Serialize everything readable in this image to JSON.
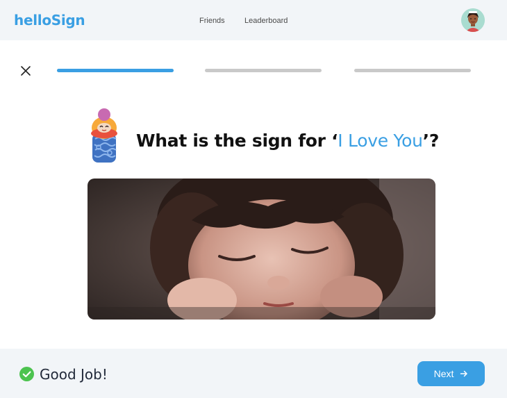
{
  "header": {
    "brand": "helloSign",
    "nav": [
      {
        "label": "Friends"
      },
      {
        "label": "Leaderboard"
      }
    ]
  },
  "progress": {
    "segments": [
      {
        "filled": 1.0
      },
      {
        "filled": 0.0
      },
      {
        "filled": 0.0
      }
    ]
  },
  "question": {
    "prefix": "What is the sign for ‘",
    "highlight": "I Love You",
    "suffix": "’?"
  },
  "footer": {
    "status": "Good Job!",
    "next_label": "Next"
  },
  "colors": {
    "accent": "#3a9fe3",
    "success": "#4cc34f",
    "header_bg": "#f2f5f8"
  },
  "icons": {
    "close": "close-icon",
    "check": "check-circle-icon",
    "arrow": "arrow-right-icon"
  }
}
